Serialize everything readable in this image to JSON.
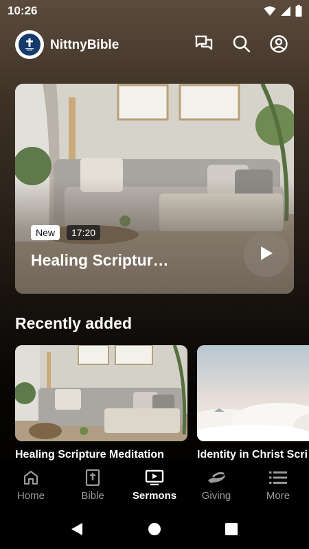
{
  "status_bar": {
    "time": "10:26",
    "icons": [
      "wifi-icon",
      "cellular-signal-icon",
      "battery-icon"
    ]
  },
  "header": {
    "app_name": "NittnyBible",
    "logo": "nittanybible-logo",
    "actions": [
      "chat-icon",
      "search-icon",
      "account-icon"
    ]
  },
  "hero": {
    "badge": "New",
    "duration": "17:20",
    "title": "Healing Scriptur…",
    "action": "play-icon"
  },
  "recently_added": {
    "title": "Recently added",
    "items": [
      {
        "title": "Healing Scripture Meditation",
        "thumbnail": "living-room-scene"
      },
      {
        "title": "Identity in Christ Scri",
        "thumbnail": "clouds-scene"
      }
    ]
  },
  "bottom_nav": {
    "items": [
      {
        "label": "Home",
        "icon": "home-icon",
        "active": false
      },
      {
        "label": "Bible",
        "icon": "bible-icon",
        "active": false
      },
      {
        "label": "Sermons",
        "icon": "tv-play-icon",
        "active": true
      },
      {
        "label": "Giving",
        "icon": "giving-hand-icon",
        "active": false
      },
      {
        "label": "More",
        "icon": "menu-list-icon",
        "active": false
      }
    ]
  },
  "system_nav": [
    "back-icon",
    "home-circle-icon",
    "recents-icon"
  ],
  "colors": {
    "background_top": "#5b4b3c",
    "background_bottom": "#000000",
    "text_primary": "#ffffff",
    "nav_inactive": "#9a9a9a"
  }
}
